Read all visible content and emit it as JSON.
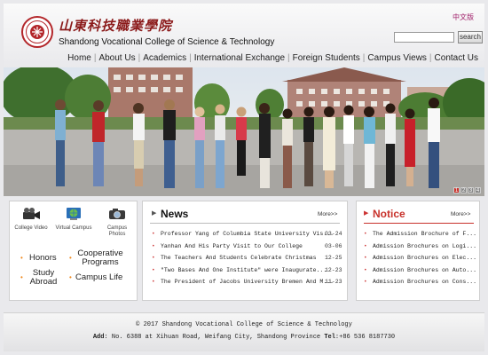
{
  "header": {
    "cn_title": "山東科技職業學院",
    "en_title": "Shandong Vocational College of Science & Technology",
    "lang_link": "中文版",
    "search_button": "search",
    "search_value": ""
  },
  "nav": [
    "Home",
    "About Us",
    "Academics",
    "International Exchange",
    "Foreign Students",
    "Campus Views",
    "Contact Us"
  ],
  "banner": {
    "pages": [
      "1",
      "2",
      "3",
      "4"
    ],
    "active_page": 1
  },
  "quick_links": {
    "icons": [
      {
        "label": "College Video",
        "icon": "film-camera-icon"
      },
      {
        "label": "Virtual Campus",
        "icon": "globe-icon"
      },
      {
        "label": "Campus Photos",
        "icon": "camera-icon"
      }
    ],
    "links": [
      "Honors",
      "Cooperative Programs",
      "Study Abroad",
      "Campus Life"
    ]
  },
  "news": {
    "title": "News",
    "more": "More>>",
    "items": [
      {
        "title": "Professor Yang of Columbia State University Vis...",
        "date": "03-24"
      },
      {
        "title": "Yanhan And His Party Visit to Our College",
        "date": "03-06"
      },
      {
        "title": "The Teachers And Students Celebrate Christmas",
        "date": "12-25"
      },
      {
        "title": "\"Two Bases And One Institute\" were Inaugurate...",
        "date": "12-23"
      },
      {
        "title": "The President of Jacobs University Bremen And M...",
        "date": "11-23"
      }
    ]
  },
  "notice": {
    "title": "Notice",
    "more": "More>>",
    "items": [
      "The Admission Brochure of F...",
      "Admission Brochures on Logi...",
      "Admission Brochures on Elec...",
      "Admission Brochures on Auto...",
      "Admission Brochures on Cons..."
    ]
  },
  "footer": {
    "copyright": "© 2017 Shandong Vocational College of Science & Technology",
    "add_label": "Add",
    "address": ": No. 6388 at Xihuan Road, Weifang City, Shandong Province ",
    "tel_label": "Tel",
    "tel": ":+86 536 8187730"
  },
  "colors": {
    "accent_red": "#c8312a",
    "bullet_orange": "#f08a20",
    "title_red": "#8b1a1a"
  }
}
